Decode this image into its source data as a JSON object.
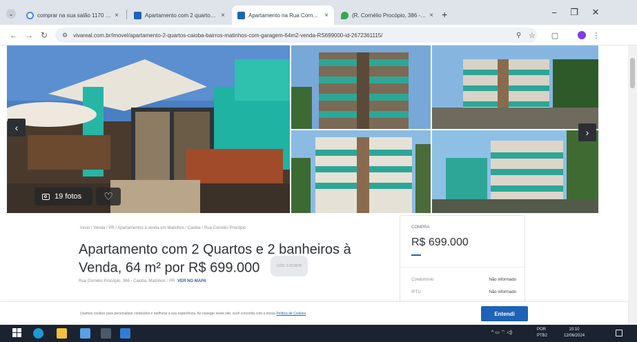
{
  "browser": {
    "tabs": [
      {
        "title": "comprar na sua salão 1170 m..",
        "favicon_color": "#4285f4",
        "active": false
      },
      {
        "title": "Apartamento com 2 quartos ...",
        "favicon_color": "#1e63b6",
        "active": false
      },
      {
        "title": "Apartamento na Rua Cornélio ...",
        "favicon_color": "#1e63b6",
        "active": true
      },
      {
        "title": "(R. Cornélio Procópio, 386 - ...",
        "favicon_color": "#34a853",
        "active": false
      }
    ],
    "new_tab": "+",
    "url": "vivareal.com.br/imovel/apartamento-2-quartos-caioba-bairros-matinhos-com-garagem-64m2-venda-RS699000-id-2672361115/"
  },
  "gallery": {
    "photos_count_label": "19 fotos",
    "icons": {
      "prev": "chevron-left-icon",
      "next": "chevron-right-icon",
      "camera": "camera-icon",
      "favorite": "heart-icon"
    }
  },
  "listing": {
    "breadcrumb": "Início / Venda / PR / Apartamentos à venda em Matinhos / Caioba / Rua Cornélio Procópio",
    "title": "Apartamento com 2 Quartos e 2 banheiros à Venda, 64 m² por R$ 699.000",
    "code": "CÓD. 3-2C0078",
    "address": "Rua Cornélio Procópio, 386 - Caioba, Matinhos - PR",
    "map_link": "VER NO MAPA"
  },
  "price_card": {
    "label": "COMPRA",
    "price": "R$ 699.000",
    "fees": [
      {
        "key": "Condomínio",
        "value": "Não informado"
      },
      {
        "key": "IPTU",
        "value": "Não informado"
      }
    ],
    "accent_color": "#1e63b6"
  },
  "cookie": {
    "text": "Usamos cookies para personalizar conteúdos e melhorar a sua experiência. Ao navegar neste site, você concorda com a nossa",
    "policy_link": "Política de Cookies",
    "button": "Entendi"
  },
  "taskbar": {
    "lang_line1": "POR",
    "lang_line2": "PTB2",
    "time": "10:10",
    "date": "12/06/2024"
  }
}
